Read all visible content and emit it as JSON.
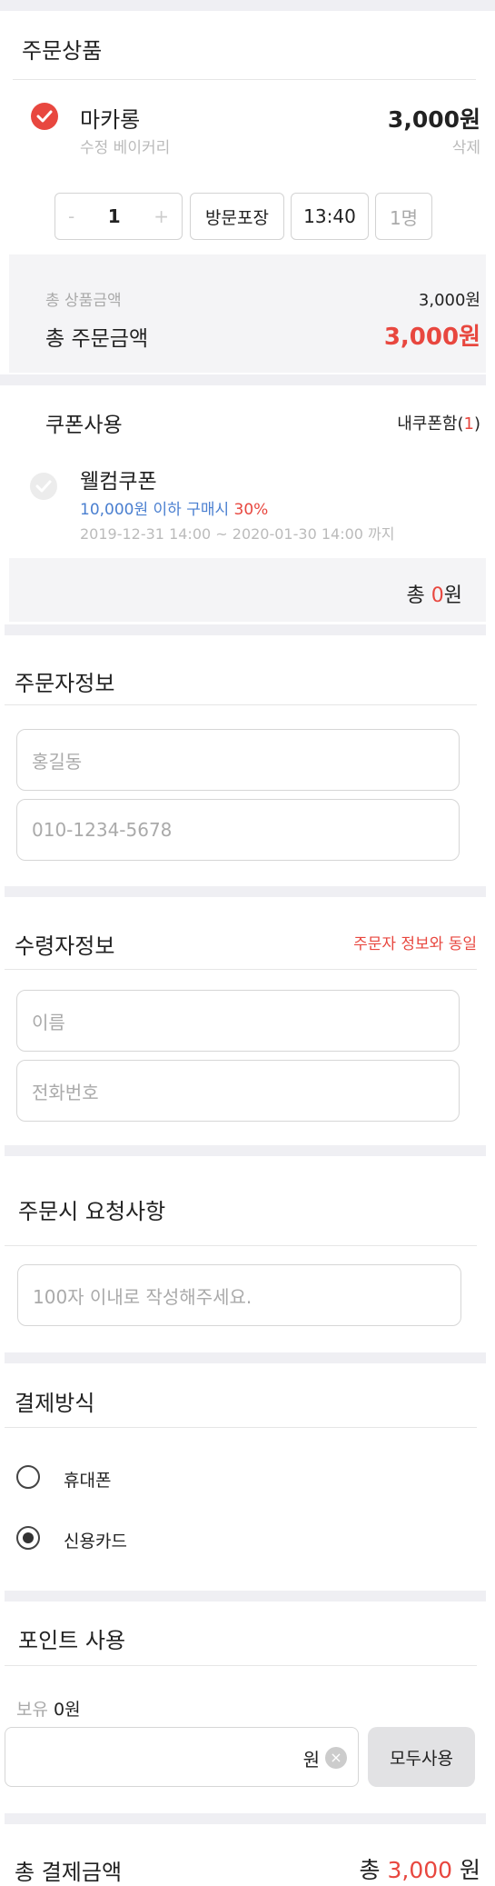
{
  "order_items": {
    "title": "주문상품",
    "item": {
      "name": "마카롱",
      "store": "수정 베이커리",
      "price": "3,000원",
      "delete_label": "삭제",
      "quantity": "1",
      "minus": "-",
      "plus": "+",
      "pickup_type": "방문포장",
      "time": "13:40",
      "people": "1명"
    },
    "subtotal_label": "총 상품금액",
    "subtotal_value": "3,000원",
    "total_label": "총 주문금액",
    "total_value": "3,000원"
  },
  "coupon": {
    "title": "쿠폰사용",
    "my_coupons_label": "내쿠폰함(",
    "my_coupons_count": "1",
    "my_coupons_close": ")",
    "coupon_name": "웰컴쿠폰",
    "condition": "10,000원 이하 구매시",
    "discount": "30%",
    "validity": "2019-12-31 14:00 ~ 2020-01-30 14:00 까지",
    "total_prefix": "총 ",
    "total_value": "0",
    "total_suffix": "원"
  },
  "orderer": {
    "title": "주문자정보",
    "name_placeholder": "홍길동",
    "phone_placeholder": "010-1234-5678"
  },
  "receiver": {
    "title": "수령자정보",
    "same_as_orderer": "주문자 정보와 동일",
    "name_placeholder": "이름",
    "phone_placeholder": "전화번호"
  },
  "request": {
    "title": "주문시 요청사항",
    "placeholder": "100자 이내로 작성해주세요."
  },
  "payment": {
    "title": "결제방식",
    "options": [
      {
        "label": "휴대폰",
        "selected": false
      },
      {
        "label": "신용카드",
        "selected": true
      }
    ]
  },
  "points": {
    "title": "포인트 사용",
    "owned_label": "보유",
    "owned_value": "0원",
    "unit": "원",
    "use_all": "모두사용"
  },
  "summary": {
    "label": "총 결제금액",
    "prefix": "총 ",
    "value": "3,000",
    "suffix": " 원"
  },
  "colors": {
    "accent": "#e8473f",
    "blue": "#4a7fd0",
    "bar": "#efeff3"
  }
}
